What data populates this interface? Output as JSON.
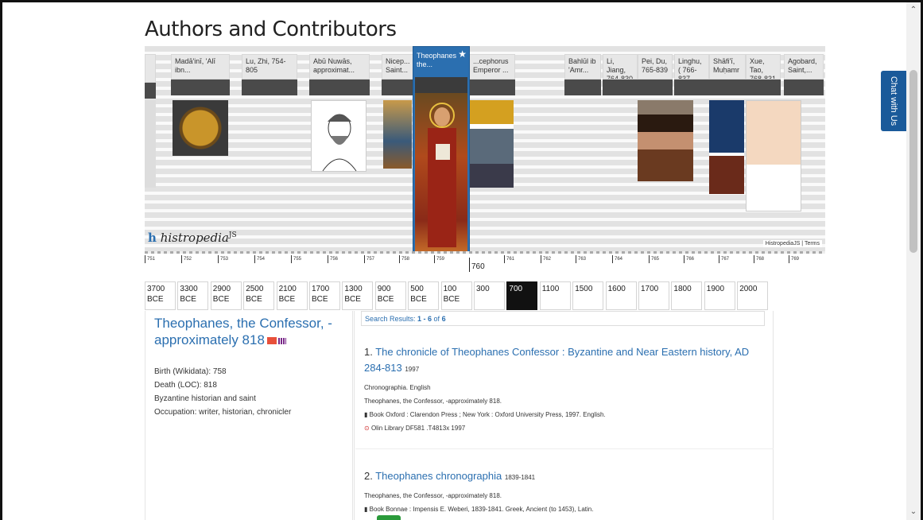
{
  "page": {
    "title": "Authors and Contributors",
    "chat_label": "Chat with Us"
  },
  "timeline": {
    "logo_text": "histropedia",
    "logo_sup": "JS",
    "terms": "HistropediaJS | Terms",
    "cards": [
      {
        "label": "Madā'inī, 'Alī ibn...",
        "pic": "coin-icon"
      },
      {
        "label": "Lu, Zhi, 754-805",
        "pic": ""
      },
      {
        "label": "Abū Nuwās, approximat...",
        "pic": "sketch-portrait"
      },
      {
        "label": "Nicep... Saint...",
        "pic": "painting"
      },
      {
        "label": "...cephorus Emperor ...",
        "pic": "coins"
      },
      {
        "label": "Bahlūl ib 'Amr...",
        "pic": ""
      },
      {
        "label": "Li, Jiang, 764-830",
        "pic": ""
      },
      {
        "label": "Pei, Du, 765-839",
        "pic": "chinese-portrait"
      },
      {
        "label": "Linghu, ( 766-837",
        "pic": ""
      },
      {
        "label": "Shāfi'ī, Muḥamr",
        "pic": "tile-pattern"
      },
      {
        "label": "Xue, Tao, 768-831",
        "pic": "ink-drawing"
      },
      {
        "label": "Agobard, Saint,...",
        "pic": ""
      }
    ],
    "selected": {
      "label": "Theophanes the...",
      "star": "★"
    },
    "ticks": [
      "751",
      "752",
      "753",
      "754",
      "755",
      "756",
      "757",
      "758",
      "759",
      "761",
      "762",
      "763",
      "764",
      "765",
      "766",
      "767",
      "768",
      "769"
    ],
    "current_year": "760"
  },
  "decades": [
    {
      "top": "3700",
      "bottom": "BCE",
      "active": false
    },
    {
      "top": "3300",
      "bottom": "BCE",
      "active": false
    },
    {
      "top": "2900",
      "bottom": "BCE",
      "active": false
    },
    {
      "top": "2500",
      "bottom": "BCE",
      "active": false
    },
    {
      "top": "2100",
      "bottom": "BCE",
      "active": false
    },
    {
      "top": "1700",
      "bottom": "BCE",
      "active": false
    },
    {
      "top": "1300",
      "bottom": "BCE",
      "active": false
    },
    {
      "top": "900",
      "bottom": "BCE",
      "active": false
    },
    {
      "top": "500",
      "bottom": "BCE",
      "active": false
    },
    {
      "top": "100",
      "bottom": "BCE",
      "active": false
    },
    {
      "top": "300",
      "bottom": "",
      "active": false
    },
    {
      "top": "700",
      "bottom": "",
      "active": true
    },
    {
      "top": "1100",
      "bottom": "",
      "active": false
    },
    {
      "top": "1500",
      "bottom": "",
      "active": false
    },
    {
      "top": "1600",
      "bottom": "",
      "active": false
    },
    {
      "top": "1700",
      "bottom": "",
      "active": false
    },
    {
      "top": "1800",
      "bottom": "",
      "active": false
    },
    {
      "top": "1900",
      "bottom": "",
      "active": false
    },
    {
      "top": "2000",
      "bottom": "",
      "active": false
    }
  ],
  "author": {
    "name": "Theophanes, the Confessor, -approximately 818",
    "birth": "Birth (Wikidata): 758",
    "death": "Death (LOC): 818",
    "description": "Byzantine historian and saint",
    "occupation": "Occupation: writer, historian, chronicler"
  },
  "search": {
    "prefix": "Search Results: ",
    "range": "1 - 6",
    "of": " of ",
    "total": "6"
  },
  "results": [
    {
      "num": "1.",
      "title": "The chronicle of Theophanes Confessor : Byzantine and Near Eastern history, AD 284-813",
      "year": "1997",
      "uniform_title": "Chronographia. English",
      "author": "Theophanes, the Confessor, -approximately 818.",
      "format_line": "Book   Oxford : Clarendon Press ; New York : Oxford University Press, 1997.   English.",
      "location": "Olin Library DF581 .T4813x 1997"
    },
    {
      "num": "2.",
      "title": "Theophanes chronographia",
      "year": "1839-1841",
      "author": "Theophanes, the Confessor, -approximately 818.",
      "format_line": "Book   Bonnae : Impensis E. Weberi, 1839-1841.   Greek, Ancient (to 1453), Latin."
    }
  ]
}
